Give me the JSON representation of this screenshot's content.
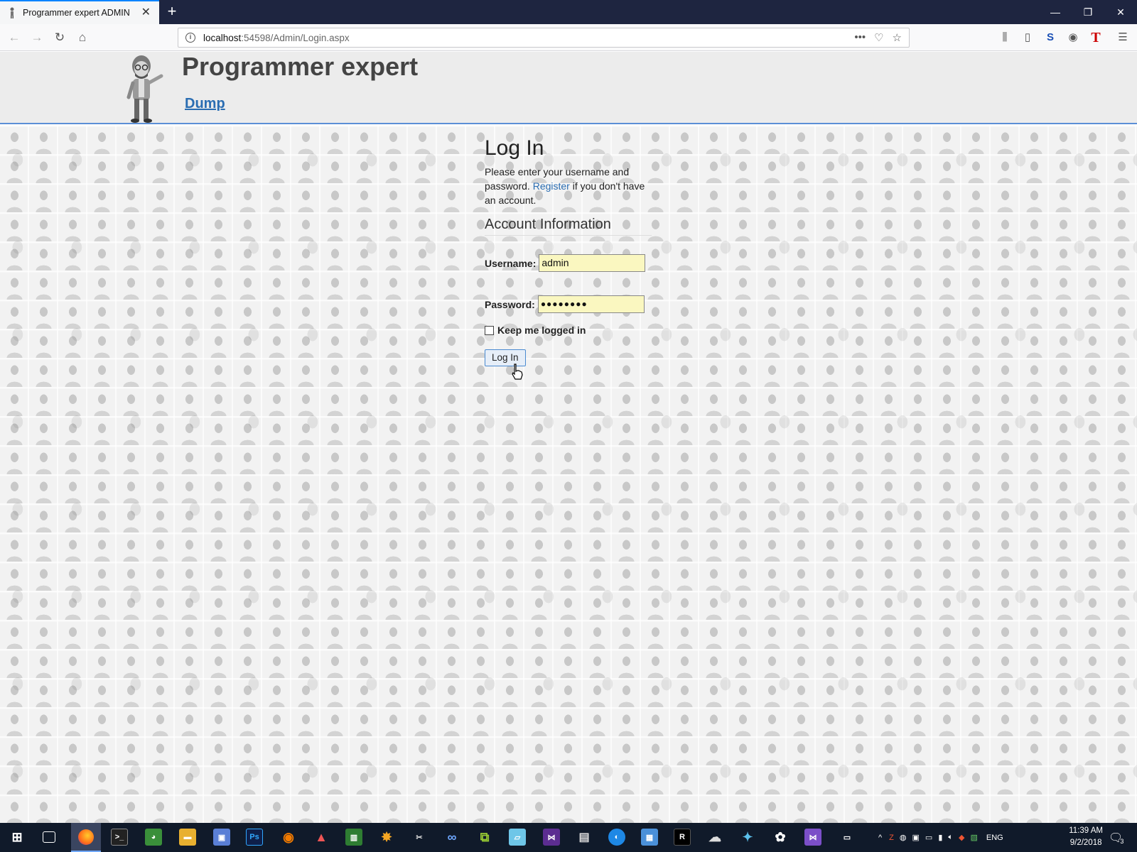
{
  "browser": {
    "tab_title": "Programmer expert ADMIN",
    "url_host": "localhost",
    "url_path": ":54598/Admin/Login.aspx"
  },
  "site": {
    "title": "Programmer expert",
    "menu": [
      {
        "label": "Dump"
      }
    ]
  },
  "login": {
    "heading": "Log In",
    "intro_before": "Please enter your username and password. ",
    "register_link": "Register",
    "intro_after": " if you don't have an account.",
    "section_title": "Account Information",
    "username_label": "Username:",
    "username_value": "admin",
    "password_label": "Password:",
    "password_value": "●●●●●●●●",
    "keep_logged_label": "Keep me logged in",
    "keep_logged_checked": false,
    "submit_label": "Log In"
  },
  "taskbar": {
    "language": "ENG",
    "time": "11:39 AM",
    "date": "9/2/2018",
    "notification_count": "3",
    "apps": [
      "start-icon",
      "task-view-icon",
      "firefox-icon",
      "terminal-icon",
      "chrome-icon",
      "file-explorer-icon",
      "save-icon",
      "photoshop-icon",
      "blender-icon",
      "app-icon",
      "chart-app-icon",
      "paint-icon",
      "tools-icon",
      "infinity-icon",
      "puzzle-icon",
      "notepad-icon",
      "visual-studio-icon",
      "video-icon",
      "app-blue-icon",
      "documents-icon",
      "rider-icon",
      "cloud-icon",
      "network-icon",
      "settings-icon",
      "visual-studio-2-icon",
      "keyboard-icon"
    ]
  },
  "colors": {
    "accent_link": "#2a6db2",
    "input_bg": "#faf7c0",
    "header_bg": "#ececec"
  }
}
